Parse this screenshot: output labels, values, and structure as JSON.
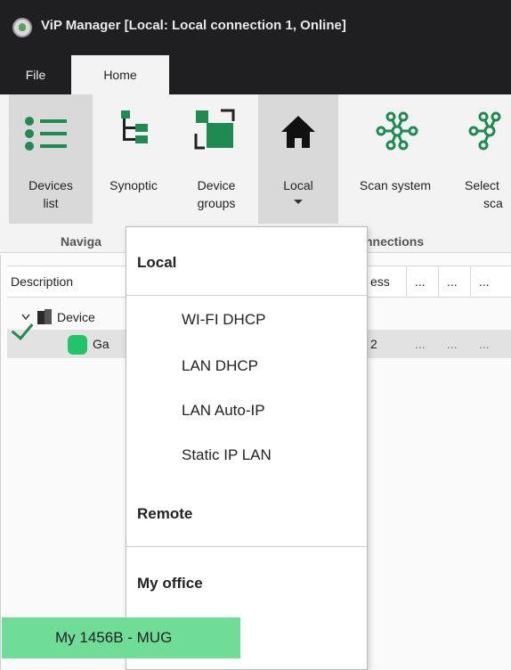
{
  "window": {
    "title": "ViP Manager [Local: Local connection 1, Online]"
  },
  "menu": {
    "file": "File",
    "home": "Home"
  },
  "ribbon": {
    "buttons": [
      {
        "label_line1": "Devices",
        "label_line2": "list",
        "icon": "list-icon"
      },
      {
        "label_line1": "Synoptic",
        "icon": "synoptic-tree-icon"
      },
      {
        "label_line1": "Device",
        "label_line2": "groups",
        "icon": "device-groups-icon"
      },
      {
        "label_line1": "Local",
        "icon": "home-icon"
      },
      {
        "label_line1": "Scan system",
        "icon": "network-icon"
      },
      {
        "label_line1": "Select",
        "label_line2": "sca",
        "icon": "network-icon"
      }
    ],
    "groups": {
      "navigation": "Naviga",
      "connections": "nnections"
    }
  },
  "table": {
    "columns": [
      "Description",
      "ess",
      "...",
      "...",
      "..."
    ],
    "rows": [
      {
        "label": "Device",
        "icon": "device-icon",
        "expand": "chevron-down-icon"
      },
      {
        "label": "Ga",
        "icon": "gateway-status-icon",
        "address": "2",
        "extra": [
          "...",
          "...",
          "..."
        ]
      }
    ]
  },
  "dropdown": {
    "local_header": "Local",
    "local_items": [
      "WI-FI DHCP",
      "LAN DHCP",
      "LAN Auto-IP",
      "Static IP LAN"
    ],
    "remote_header": "Remote",
    "office_header": "My office",
    "office_items": [
      "My 1456B - MUG"
    ]
  },
  "colors": {
    "accent_green": "#1f8a52",
    "selected_item": "#6fdc98",
    "titlebar": "#1f1f22"
  }
}
